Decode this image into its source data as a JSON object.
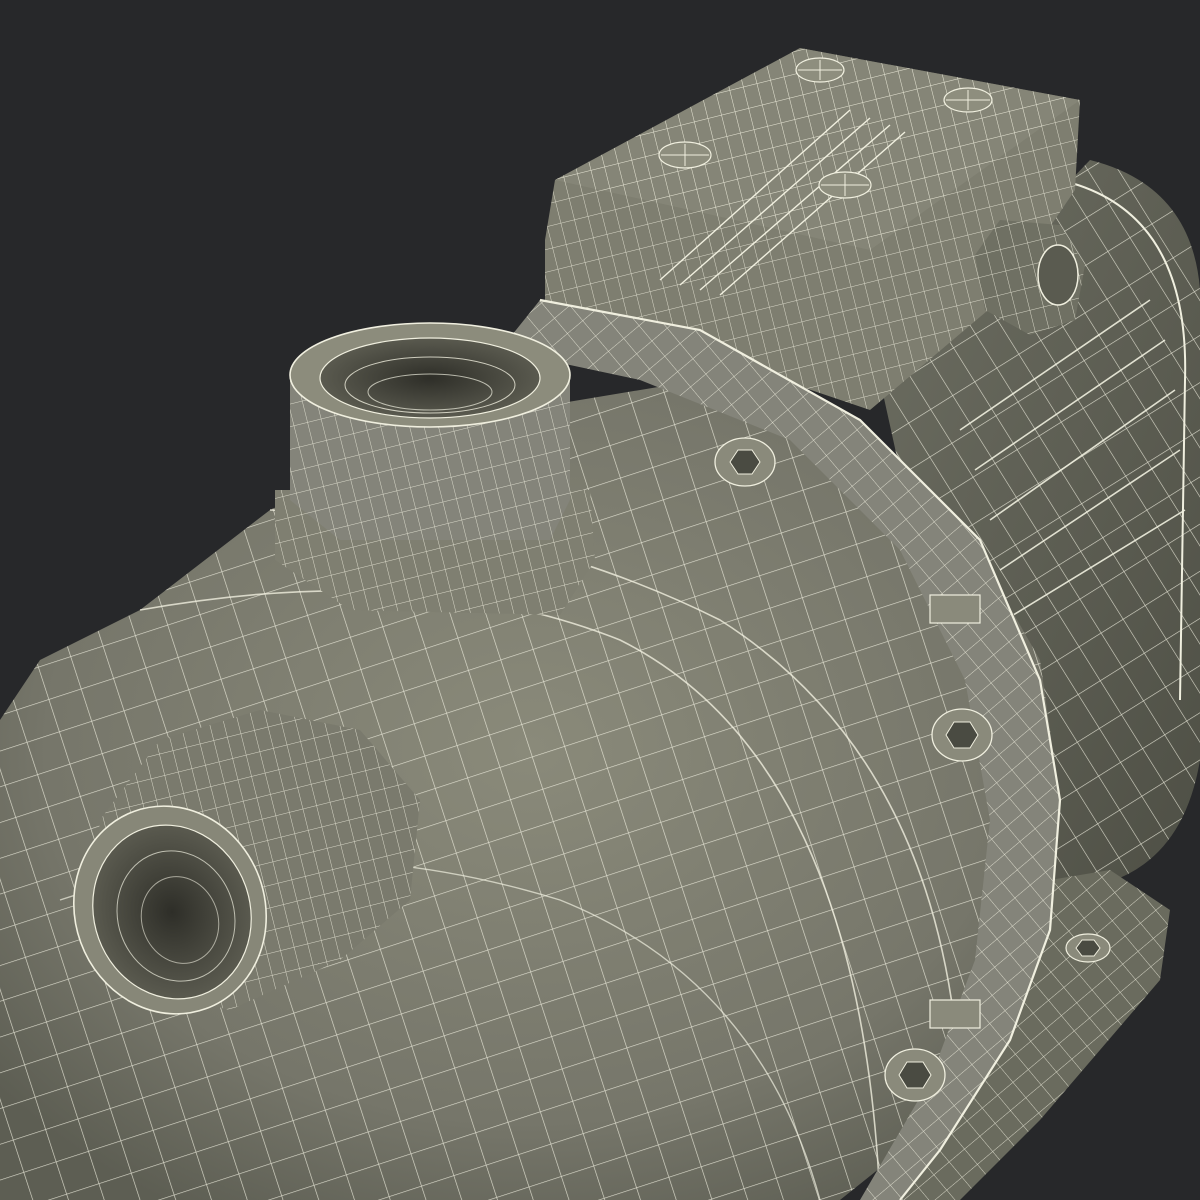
{
  "scene": {
    "subject": "pump-wireframe",
    "background_color": "#27282a",
    "body_color": "#7b7b6d",
    "body_shadow_color": "#4e4f45",
    "highlight_color": "#9a9a88",
    "wire_color": "#f0efdf",
    "inner_color": "#3a3a33"
  },
  "parts": {
    "terminal_box": "terminal-box",
    "motor_housing": "motor-housing",
    "cable_gland": "cable-gland",
    "base_plate": "base-plate",
    "pump_casing": "pump-casing",
    "flange": "flange",
    "outlet_port": "outlet-port",
    "inlet_port": "inlet-port",
    "bolts": [
      "bolt-head",
      "bolt-head",
      "bolt-head",
      "bolt-head",
      "bolt-head",
      "bolt-head"
    ],
    "screws": [
      "screw-head",
      "screw-head",
      "screw-head",
      "screw-head"
    ]
  }
}
